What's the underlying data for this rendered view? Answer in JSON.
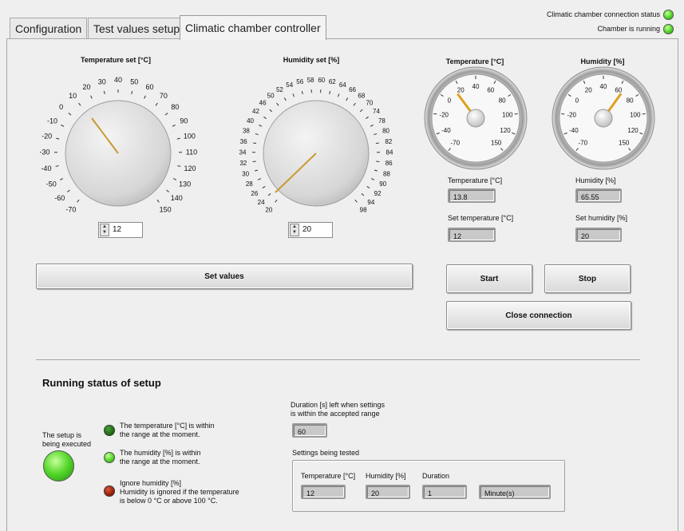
{
  "tabs": [
    {
      "label": "Configuration"
    },
    {
      "label": "Test values setup"
    },
    {
      "label": "Climatic chamber controller"
    }
  ],
  "status": {
    "connection_label": "Climatic chamber connection status",
    "running_label": "Chamber is running"
  },
  "temp_knob": {
    "title": "Temperature set [°C]",
    "ticks": [
      "-70",
      "-60",
      "-50",
      "-40",
      "-30",
      "-20",
      "-10",
      "0",
      "10",
      "20",
      "30",
      "40",
      "50",
      "60",
      "70",
      "80",
      "90",
      "100",
      "110",
      "120",
      "130",
      "140",
      "150"
    ],
    "value": "12"
  },
  "hum_knob": {
    "title": "Humidity set [%]",
    "ticks": [
      "20",
      "24",
      "26",
      "28",
      "30",
      "32",
      "34",
      "36",
      "38",
      "40",
      "42",
      "46",
      "50",
      "52",
      "54",
      "56",
      "58",
      "60",
      "62",
      "64",
      "66",
      "68",
      "70",
      "74",
      "78",
      "80",
      "82",
      "84",
      "86",
      "88",
      "90",
      "92",
      "94",
      "98"
    ],
    "value": "20"
  },
  "temp_gauge": {
    "title": "Temperature [°C]",
    "ticks": [
      "-70",
      "-40",
      "-20",
      "0",
      "20",
      "40",
      "60",
      "80",
      "100",
      "120",
      "150"
    ],
    "value": 13.8
  },
  "hum_gauge": {
    "title": "Humidity [%]",
    "ticks": [
      "-70",
      "-40",
      "-20",
      "0",
      "20",
      "40",
      "60",
      "80",
      "100",
      "120",
      "150"
    ],
    "value": 65.55
  },
  "readouts": {
    "temperature_label": "Temperature [°C]",
    "temperature_value": "13.8",
    "humidity_label": "Humidity [%]",
    "humidity_value": "65.55",
    "set_temperature_label": "Set temperature [°C]",
    "set_temperature_value": "12",
    "set_humidity_label": "Set humidity [%]",
    "set_humidity_value": "20"
  },
  "buttons": {
    "set_values": "Set values",
    "start": "Start",
    "stop": "Stop",
    "close_connection": "Close connection"
  },
  "running": {
    "heading": "Running status of setup",
    "executing_label": "The setup is\nbeing executed",
    "temp_in_range": "The temperature [°C] is within\nthe range at the moment.",
    "hum_in_range": "The humidity [%] is within\nthe range at the moment.",
    "ignore_humidity": "Ignore humidity [%]\nHumidity is ignored if the temperature\nis below 0 °C or above 100 °C.",
    "duration_label": "Duration [s] left when settings\nis within the accepted range",
    "duration_value": "60",
    "settings_label": "Settings being tested",
    "settings_temp_label": "Temperature [°C]",
    "settings_temp_value": "12",
    "settings_hum_label": "Humidity [%]",
    "settings_hum_value": "20",
    "settings_duration_label": "Duration",
    "settings_duration_value": "1",
    "settings_unit_value": "Minute(s)"
  },
  "colors": {
    "led_on": "#56d82b",
    "led_dark": "#1f6a12",
    "led_red": "#9b1c08",
    "gauge_needle": "#e0a020",
    "knob_needle": "#c89a30"
  }
}
